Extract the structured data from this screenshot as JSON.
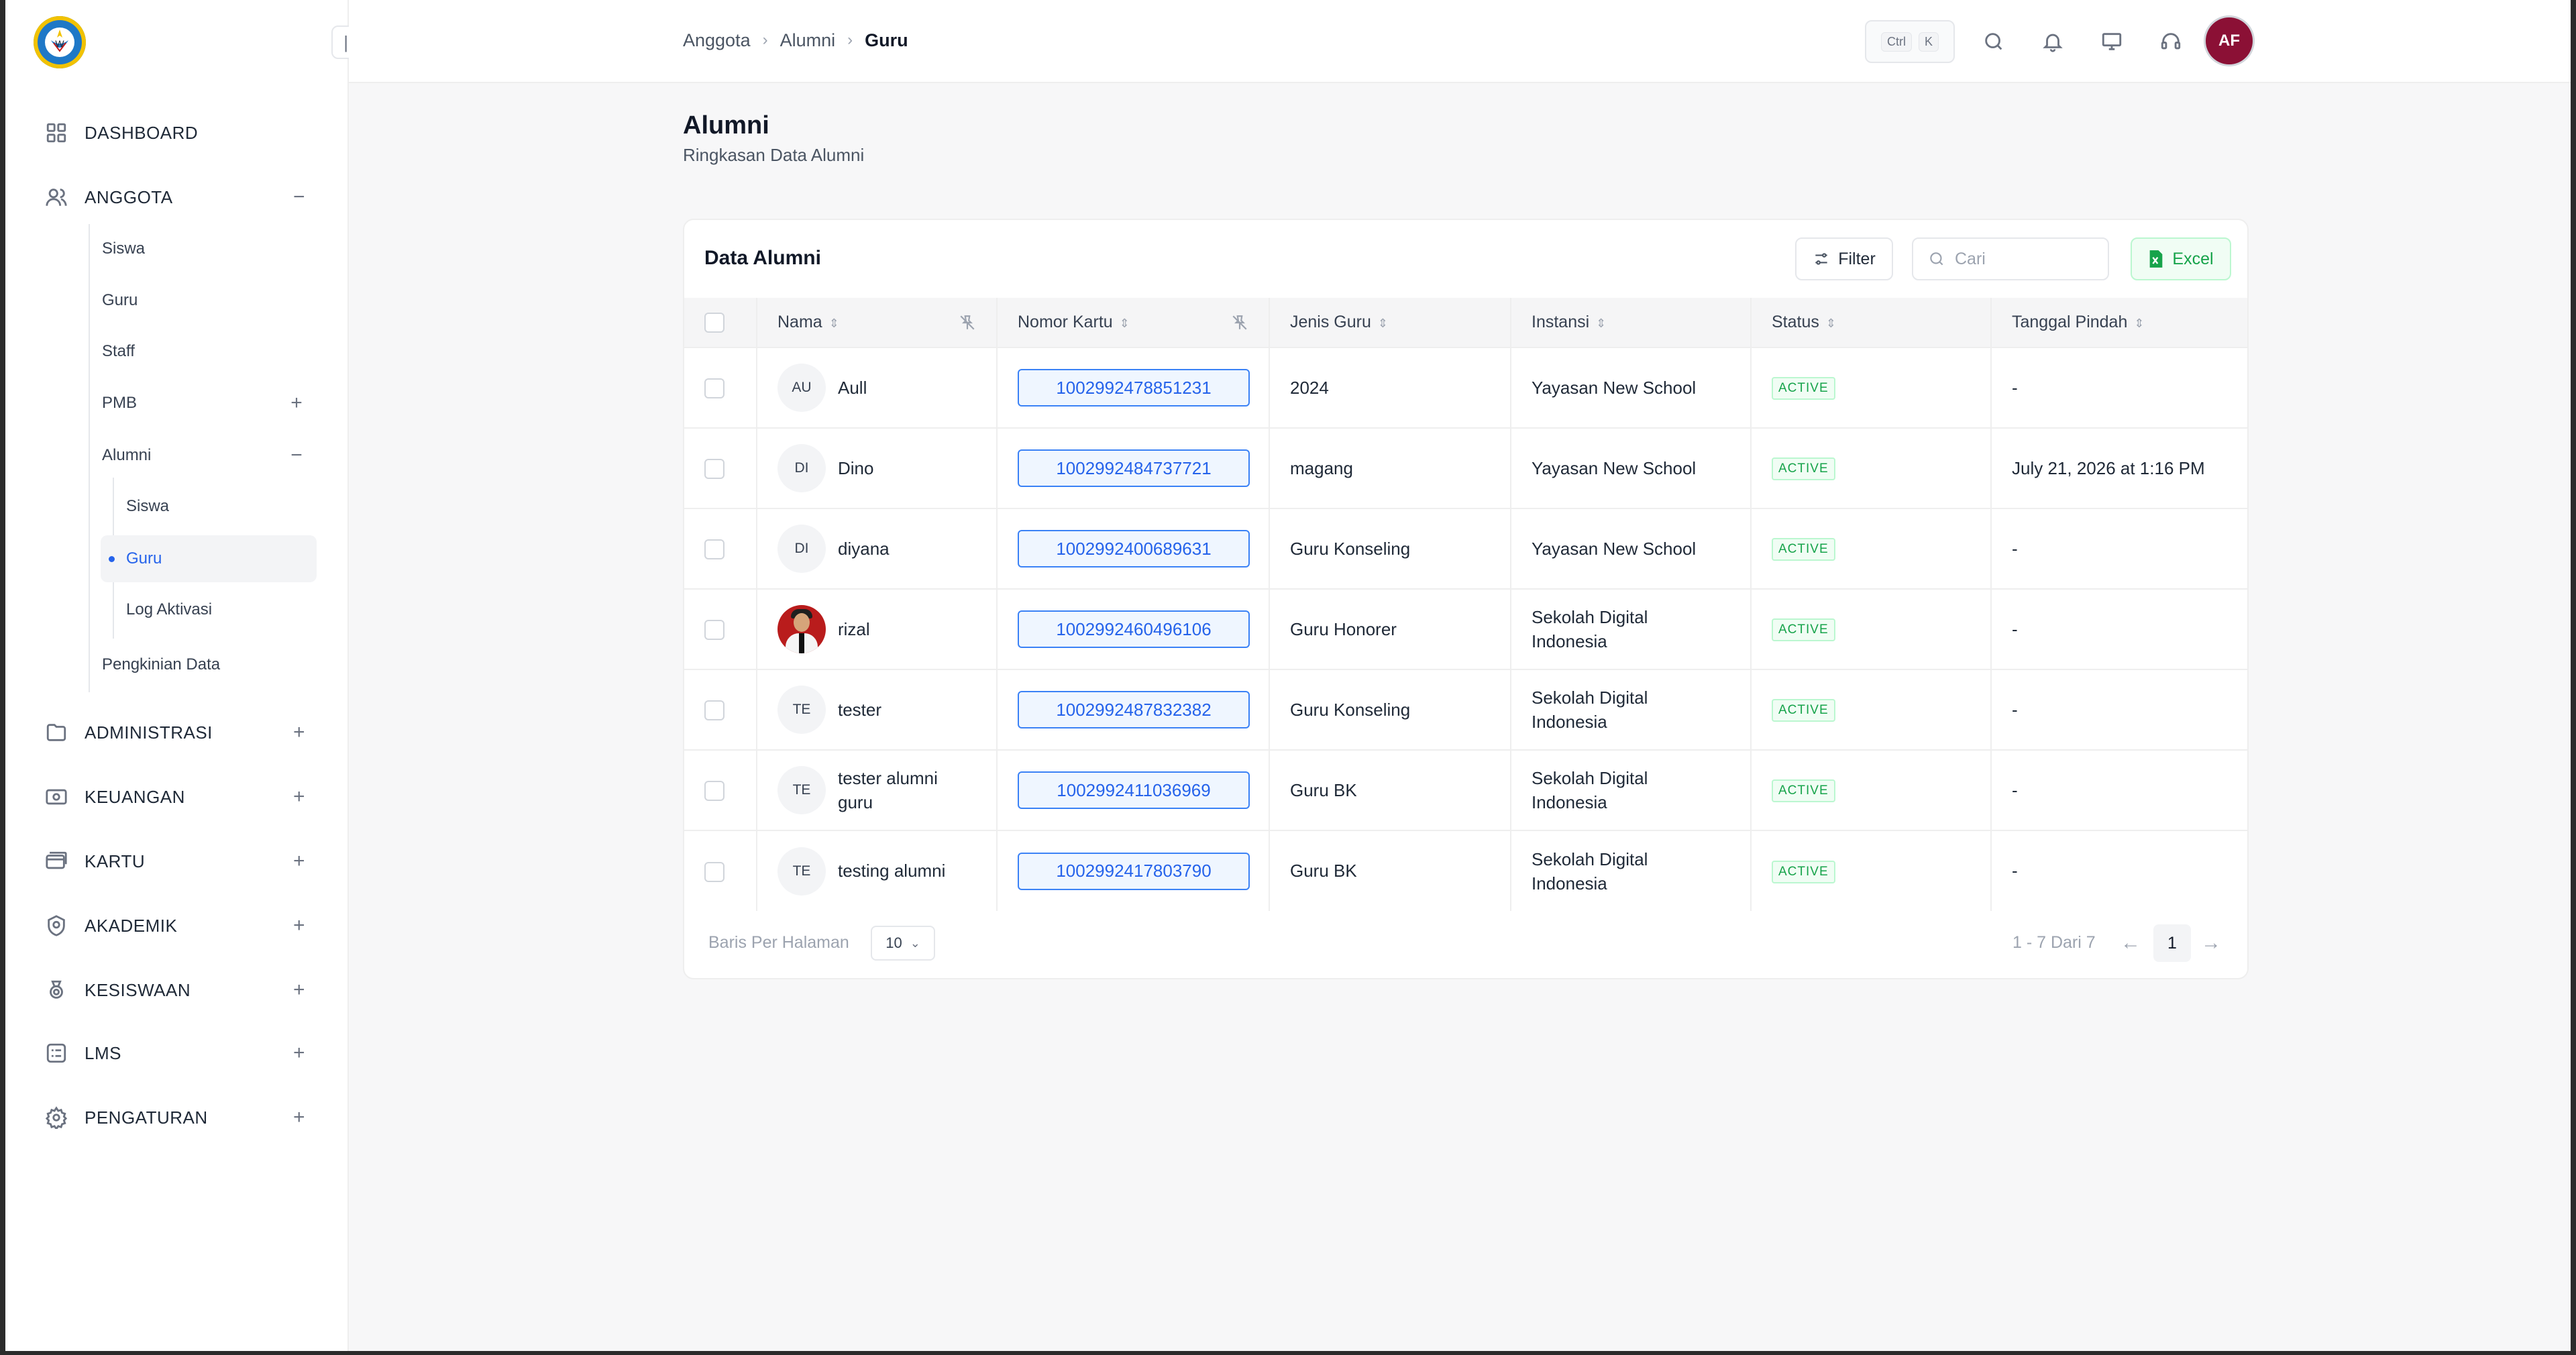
{
  "sidebar": {
    "items": [
      {
        "label": "DASHBOARD",
        "icon": "grid-icon",
        "toggle": ""
      },
      {
        "label": "ANGGOTA",
        "icon": "users-icon",
        "toggle": "−"
      },
      {
        "label": "ADMINISTRASI",
        "icon": "folder-icon",
        "toggle": "+"
      },
      {
        "label": "KEUANGAN",
        "icon": "money-icon",
        "toggle": "+"
      },
      {
        "label": "KARTU",
        "icon": "card-icon",
        "toggle": "+"
      },
      {
        "label": "AKADEMIK",
        "icon": "shield-icon",
        "toggle": "+"
      },
      {
        "label": "KESISWAAN",
        "icon": "medal-icon",
        "toggle": "+"
      },
      {
        "label": "LMS",
        "icon": "list-icon",
        "toggle": "+"
      },
      {
        "label": "PENGATURAN",
        "icon": "gear-icon",
        "toggle": "+"
      }
    ],
    "anggota_sub": [
      {
        "label": "Siswa",
        "toggle": ""
      },
      {
        "label": "Guru",
        "toggle": ""
      },
      {
        "label": "Staff",
        "toggle": ""
      },
      {
        "label": "PMB",
        "toggle": "+"
      },
      {
        "label": "Alumni",
        "toggle": "−"
      },
      {
        "label": "Pengkinian Data",
        "toggle": ""
      }
    ],
    "alumni_sub": [
      {
        "label": "Siswa"
      },
      {
        "label": "Guru"
      },
      {
        "label": "Log Aktivasi"
      }
    ]
  },
  "topbar": {
    "breadcrumb": [
      "Anggota",
      "Alumni",
      "Guru"
    ],
    "shortcut": {
      "key1": "Ctrl",
      "key2": "K"
    },
    "avatar": "AF"
  },
  "page": {
    "title": "Alumni",
    "subtitle": "Ringkasan Data Alumni"
  },
  "card": {
    "title": "Data Alumni",
    "filter_label": "Filter",
    "search_placeholder": "Cari",
    "excel_label": "Excel",
    "columns": [
      "Nama",
      "Nomor Kartu",
      "Jenis Guru",
      "Instansi",
      "Status",
      "Tanggal Pindah"
    ],
    "rows": [
      {
        "initials": "AU",
        "name": "Aull",
        "card": "1002992478851231",
        "jenis": "2024",
        "instansi": "Yayasan New School",
        "status": "ACTIVE",
        "tanggal": "-"
      },
      {
        "initials": "DI",
        "name": "Dino",
        "card": "1002992484737721",
        "jenis": "magang",
        "instansi": "Yayasan New School",
        "status": "ACTIVE",
        "tanggal": "July 21, 2026 at 1:16 PM"
      },
      {
        "initials": "DI",
        "name": "diyana",
        "card": "1002992400689631",
        "jenis": "Guru Konseling",
        "instansi": "Yayasan New School",
        "status": "ACTIVE",
        "tanggal": "-"
      },
      {
        "initials": "",
        "name": "rizal",
        "card": "1002992460496106",
        "jenis": "Guru Honorer",
        "instansi": "Sekolah Digital Indonesia",
        "status": "ACTIVE",
        "tanggal": "-"
      },
      {
        "initials": "TE",
        "name": "tester",
        "card": "1002992487832382",
        "jenis": "Guru Konseling",
        "instansi": "Sekolah Digital Indonesia",
        "status": "ACTIVE",
        "tanggal": "-"
      },
      {
        "initials": "TE",
        "name": "tester alumni guru",
        "card": "1002992411036969",
        "jenis": "Guru BK",
        "instansi": "Sekolah Digital Indonesia",
        "status": "ACTIVE",
        "tanggal": "-"
      },
      {
        "initials": "TE",
        "name": "testing alumni",
        "card": "1002992417803790",
        "jenis": "Guru BK",
        "instansi": "Sekolah Digital Indonesia",
        "status": "ACTIVE",
        "tanggal": "-"
      }
    ],
    "pagination": {
      "rows_per_page_label": "Baris Per Halaman",
      "rows_per_page": "10",
      "range": "1 - 7 Dari 7",
      "page": "1"
    }
  },
  "colors": {
    "accent": "#2563eb",
    "success": "#16a34a",
    "avatar_bg": "#8b1035"
  }
}
